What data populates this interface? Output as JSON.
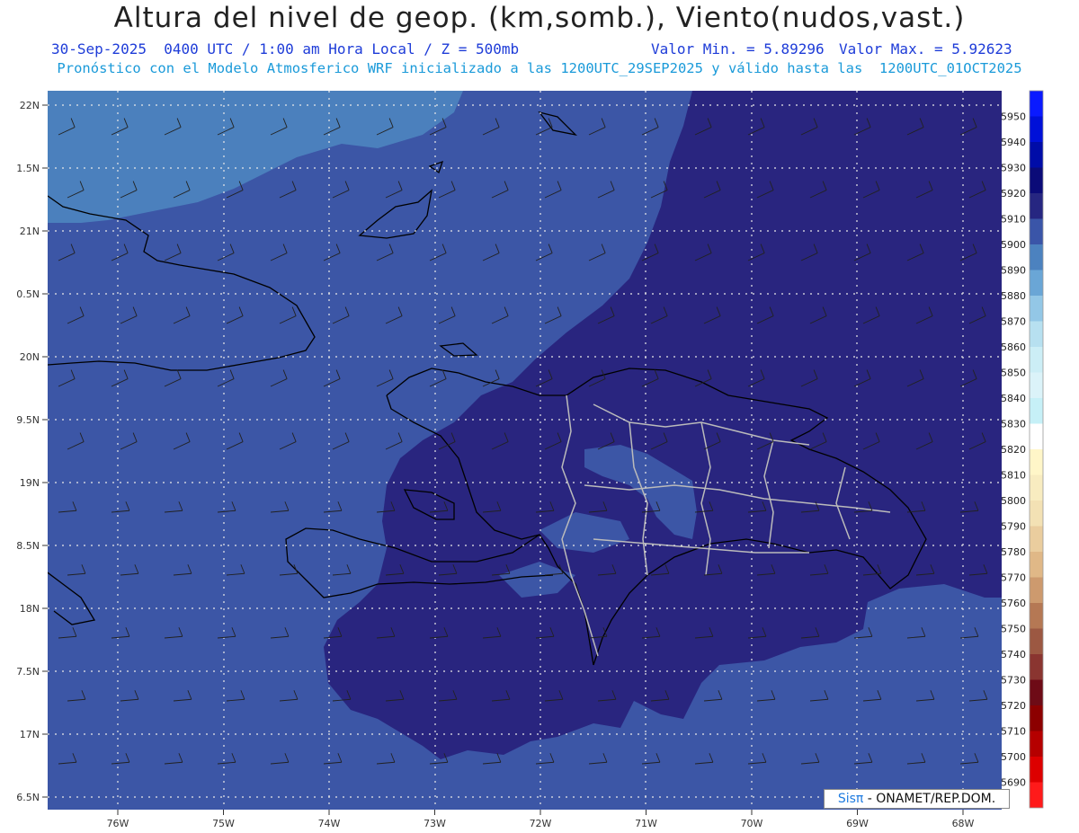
{
  "title": "Altura del nivel de geop. (km,somb.), Viento(nudos,vast.)",
  "subtitle": {
    "datetime": "30-Sep-2025  0400 UTC / 1:00 am Hora Local / Z = 500mb",
    "min": "Valor Min. = 5.89296",
    "max": "Valor Max. = 5.92623"
  },
  "model_line": "Pronóstico con el Modelo Atmosferico WRF inicializado a las 1200UTC_29SEP2025 y válido hasta las  1200UTC_01OCT2025",
  "lat_labels": [
    "22N",
    "1.5N",
    "21N",
    "0.5N",
    "20N",
    "9.5N",
    "19N",
    "8.5N",
    "18N",
    "7.5N",
    "17N",
    "6.5N"
  ],
  "lon_labels": [
    "76W",
    "75W",
    "74W",
    "73W",
    "72W",
    "71W",
    "70W",
    "69W",
    "68W"
  ],
  "colorbar": {
    "labels": [
      "5950",
      "5940",
      "5930",
      "5920",
      "5910",
      "5900",
      "5890",
      "5880",
      "5870",
      "5860",
      "5850",
      "5840",
      "5830",
      "5820",
      "5810",
      "5800",
      "5790",
      "5780",
      "5770",
      "5760",
      "5750",
      "5740",
      "5730",
      "5720",
      "5710",
      "5700",
      "5690"
    ],
    "colors": [
      "#0a1aff",
      "#0010d8",
      "#000ca8",
      "#0b0b78",
      "#262681",
      "#3a55a8",
      "#4c82bf",
      "#6aa6d6",
      "#93c7e6",
      "#b7e0f0",
      "#cceef6",
      "#dbf3f9",
      "#c6f0f7",
      "#ffffff",
      "#fff6c8",
      "#f8ecc0",
      "#f3e1b4",
      "#eacd9e",
      "#e0b887",
      "#cd9a6e",
      "#b57854",
      "#9c5842",
      "#8a3530",
      "#6e0b16",
      "#8c0000",
      "#b50000",
      "#dd0000",
      "#ff1a1a"
    ]
  },
  "colors": {
    "fill_5890": "#4b80bd",
    "fill_5900": "#3c56a6",
    "fill_5910": "#29257f",
    "coast": "#000000",
    "borders": "#bbbbbb",
    "grid": "#e8e8e8"
  },
  "credit": {
    "brand": "Sisπ",
    "text": "- ONAMET/REP.DOM."
  }
}
